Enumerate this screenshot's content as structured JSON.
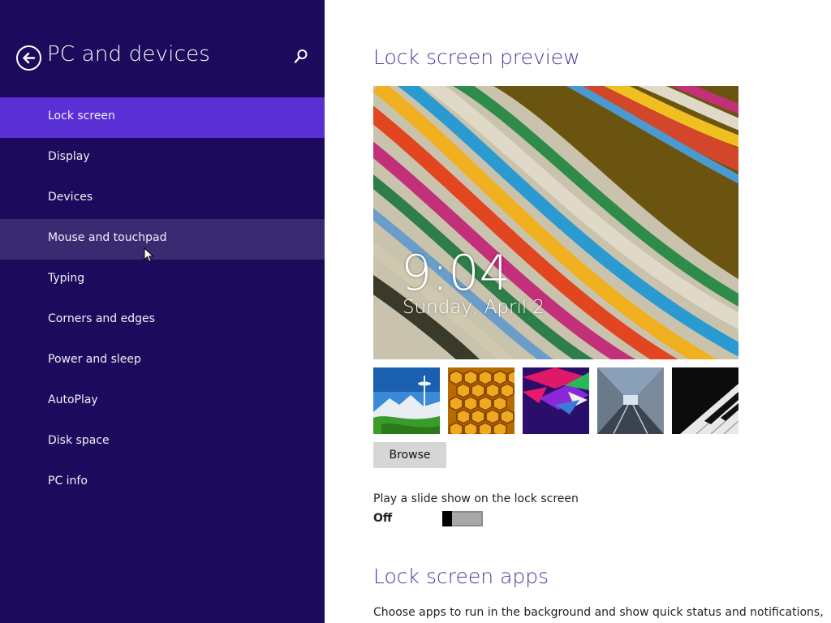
{
  "sidebar": {
    "title": "PC and devices",
    "back_icon": "back-arrow-icon",
    "search_icon": "search-icon",
    "items": [
      {
        "label": "Lock screen",
        "state": "selected"
      },
      {
        "label": "Display",
        "state": "normal"
      },
      {
        "label": "Devices",
        "state": "normal"
      },
      {
        "label": "Mouse and touchpad",
        "state": "hover"
      },
      {
        "label": "Typing",
        "state": "normal"
      },
      {
        "label": "Corners and edges",
        "state": "normal"
      },
      {
        "label": "Power and sleep",
        "state": "normal"
      },
      {
        "label": "AutoPlay",
        "state": "normal"
      },
      {
        "label": "Disk space",
        "state": "normal"
      },
      {
        "label": "PC info",
        "state": "normal"
      }
    ]
  },
  "main": {
    "preview_heading": "Lock screen preview",
    "preview": {
      "time": "9:04",
      "date": "Sunday, April 2"
    },
    "thumbnails": [
      "space-needle-image",
      "honeycomb-image",
      "geometric-shapes-image",
      "tunnel-image",
      "piano-keys-image"
    ],
    "browse_label": "Browse",
    "slideshow": {
      "label": "Play a slide show on the lock screen",
      "state": "Off",
      "on": false
    },
    "apps_heading": "Lock screen apps",
    "apps_description": "Choose apps to run in the background and show quick status and notifications,"
  },
  "colors": {
    "sidebar_bg": "#1c0a5c",
    "selected_bg": "#5a2fd4",
    "hover_bg": "#3a2a72",
    "heading": "#4a3b9c"
  }
}
